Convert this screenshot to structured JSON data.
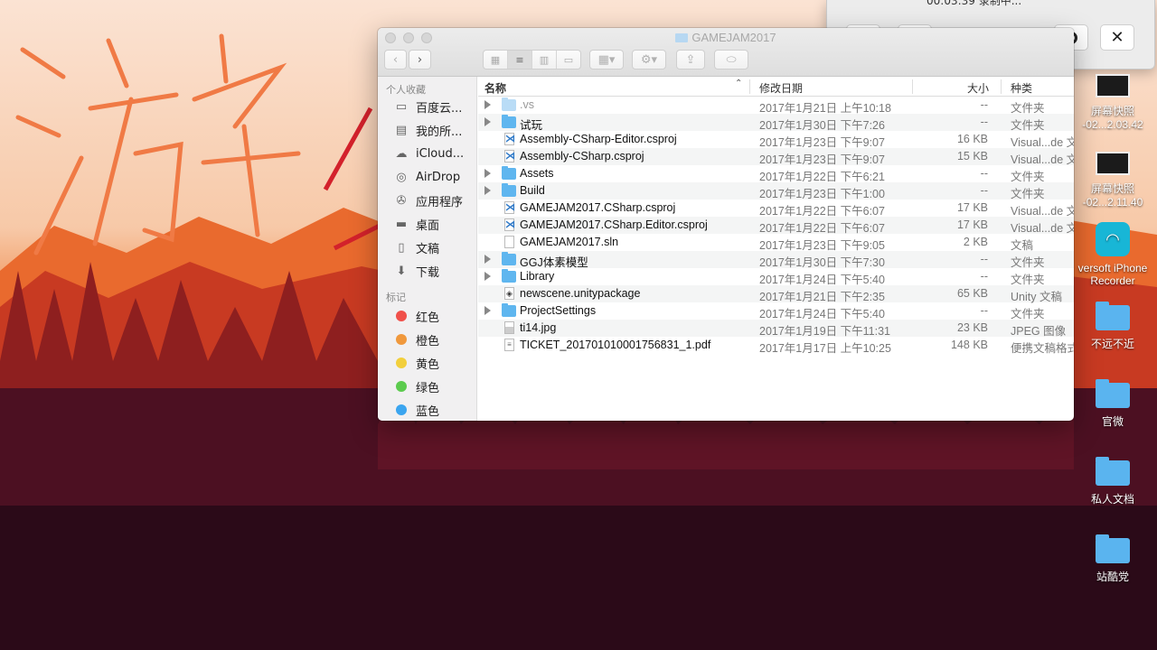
{
  "recorder": {
    "time_label": "00:03:39 录制中..."
  },
  "window": {
    "title": "GAMEJAM2017"
  },
  "sidebar": {
    "favorites_header": "个人收藏",
    "favorites": [
      {
        "label": "百度云...",
        "icon": "folder-icon"
      },
      {
        "label": "我的所...",
        "icon": "all-files-icon"
      },
      {
        "label": "iCloud...",
        "icon": "cloud-icon"
      },
      {
        "label": "AirDrop",
        "icon": "airdrop-icon"
      },
      {
        "label": "应用程序",
        "icon": "applications-icon"
      },
      {
        "label": "桌面",
        "icon": "desktop-icon"
      },
      {
        "label": "文稿",
        "icon": "documents-icon"
      },
      {
        "label": "下载",
        "icon": "downloads-icon"
      }
    ],
    "tags_header": "标记",
    "tags": [
      {
        "label": "红色",
        "color": "#f0504a"
      },
      {
        "label": "橙色",
        "color": "#f0983c"
      },
      {
        "label": "黄色",
        "color": "#f2cf3c"
      },
      {
        "label": "绿色",
        "color": "#5ccb4e"
      },
      {
        "label": "蓝色",
        "color": "#3ba5ef"
      }
    ]
  },
  "columns": {
    "name": "名称",
    "date": "修改日期",
    "size": "大小",
    "kind": "种类"
  },
  "files": [
    {
      "name": ".vs",
      "date": "2017年1月21日 上午10:18",
      "size": "--",
      "kind": "文件夹",
      "type": "folder"
    },
    {
      "name": "试玩",
      "date": "2017年1月30日 下午7:26",
      "size": "--",
      "kind": "文件夹",
      "type": "folder"
    },
    {
      "name": "Assembly-CSharp-Editor.csproj",
      "date": "2017年1月23日 下午9:07",
      "size": "16 KB",
      "kind": "Visual...de 文稿",
      "type": "vs"
    },
    {
      "name": "Assembly-CSharp.csproj",
      "date": "2017年1月23日 下午9:07",
      "size": "15 KB",
      "kind": "Visual...de 文稿",
      "type": "vs"
    },
    {
      "name": "Assets",
      "date": "2017年1月22日 下午6:21",
      "size": "--",
      "kind": "文件夹",
      "type": "folder"
    },
    {
      "name": "Build",
      "date": "2017年1月23日 下午1:00",
      "size": "--",
      "kind": "文件夹",
      "type": "folder"
    },
    {
      "name": "GAMEJAM2017.CSharp.csproj",
      "date": "2017年1月22日 下午6:07",
      "size": "17 KB",
      "kind": "Visual...de 文稿",
      "type": "vs"
    },
    {
      "name": "GAMEJAM2017.CSharp.Editor.csproj",
      "date": "2017年1月22日 下午6:07",
      "size": "17 KB",
      "kind": "Visual...de 文稿",
      "type": "vs"
    },
    {
      "name": "GAMEJAM2017.sln",
      "date": "2017年1月23日 下午9:05",
      "size": "2 KB",
      "kind": "文稿",
      "type": "doc"
    },
    {
      "name": "GGJ体素模型",
      "date": "2017年1月30日 下午7:30",
      "size": "--",
      "kind": "文件夹",
      "type": "folder"
    },
    {
      "name": "Library",
      "date": "2017年1月24日 下午5:40",
      "size": "--",
      "kind": "文件夹",
      "type": "folder"
    },
    {
      "name": "newscene.unitypackage",
      "date": "2017年1月21日 下午2:35",
      "size": "65 KB",
      "kind": "Unity 文稿",
      "type": "unity"
    },
    {
      "name": "ProjectSettings",
      "date": "2017年1月24日 下午5:40",
      "size": "--",
      "kind": "文件夹",
      "type": "folder"
    },
    {
      "name": "ti14.jpg",
      "date": "2017年1月19日 下午11:31",
      "size": "23 KB",
      "kind": "JPEG 图像",
      "type": "image"
    },
    {
      "name": "TICKET_20170101000175683​1_1.pdf",
      "date": "2017年1月17日 上午10:25",
      "size": "148 KB",
      "kind": "便携文稿格式",
      "type": "pdf"
    }
  ],
  "desktop": [
    {
      "label": "屏幕快照",
      "sublabel": "-02...2.03.42",
      "kind": "screenshot"
    },
    {
      "label": "屏幕快照",
      "sublabel": "-02...2.11.40",
      "kind": "screenshot"
    },
    {
      "label": "versoft iPhone",
      "sublabel": "Recorder",
      "kind": "app"
    },
    {
      "label": "不远不近",
      "sublabel": "",
      "kind": "folder"
    },
    {
      "label": "官微",
      "sublabel": "",
      "kind": "folder"
    },
    {
      "label": "私人文档",
      "sublabel": "",
      "kind": "folder"
    },
    {
      "label": "站酷党",
      "sublabel": "",
      "kind": "folder"
    }
  ],
  "wallpaper_text": "游"
}
